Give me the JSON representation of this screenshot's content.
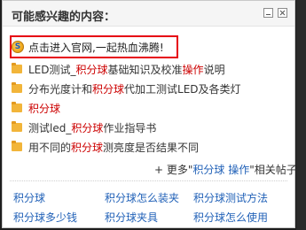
{
  "panel": {
    "title": "可能感兴趣的内容：",
    "promo_text": "点击进入官网,一起热血沸腾!",
    "promo_logo_letter": "S"
  },
  "items": [
    {
      "pre": "LED测试_",
      "kw": "积分球",
      "post": "基础知识及校准",
      "kw2": "操作",
      "post2": "说明"
    },
    {
      "pre": "分布光度计和",
      "kw": "积分球",
      "post": "代加工测试LED及各类灯",
      "kw2": "",
      "post2": ""
    },
    {
      "pre": "",
      "kw": "积分球",
      "post": "",
      "kw2": "",
      "post2": ""
    },
    {
      "pre": "测试led_",
      "kw": "积分球",
      "post": "作业指导书",
      "kw2": "",
      "post2": ""
    },
    {
      "pre": "用不同的",
      "kw": "积分球",
      "post": "测亮度是否结果不同",
      "kw2": "",
      "post2": ""
    }
  ],
  "more": {
    "prefix": "+ 更多\"",
    "keyword": "积分球 操作",
    "suffix": "\"相关帖子"
  },
  "links": [
    "积分球",
    "积分球怎么装夹",
    "积分球测试方法",
    "积分球多少钱",
    "积分球夹具",
    "积分球怎么使用"
  ],
  "icons": {
    "minimize": "minimize-icon",
    "close": "close-icon",
    "logo": "site-logo-icon",
    "folder": "folder-icon"
  },
  "colors": {
    "highlight_border": "#e60012",
    "keyword": "#cc0000",
    "link": "#2262b8",
    "folder": "#f2b53a"
  }
}
